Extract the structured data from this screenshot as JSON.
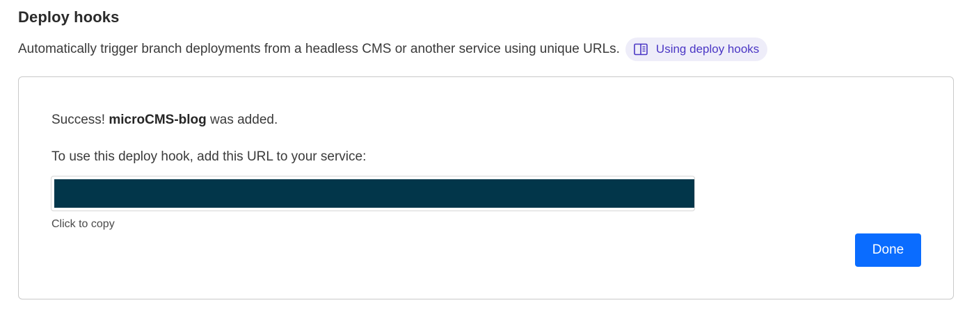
{
  "section": {
    "title": "Deploy hooks",
    "description": "Automatically trigger branch deployments from a headless CMS or another service using unique URLs.",
    "docs_link": {
      "label": "Using deploy hooks",
      "icon": "book-icon",
      "accent_color": "#4a36c4"
    }
  },
  "card": {
    "success_prefix": "Success!",
    "hook_name": "microCMS-blog",
    "success_suffix": "was added.",
    "instruction": "To use this deploy hook, add this URL to your service:",
    "url_value": "",
    "copy_hint": "Click to copy",
    "done_label": "Done",
    "done_color": "#0a6cff",
    "url_redaction_color": "#02364a"
  }
}
